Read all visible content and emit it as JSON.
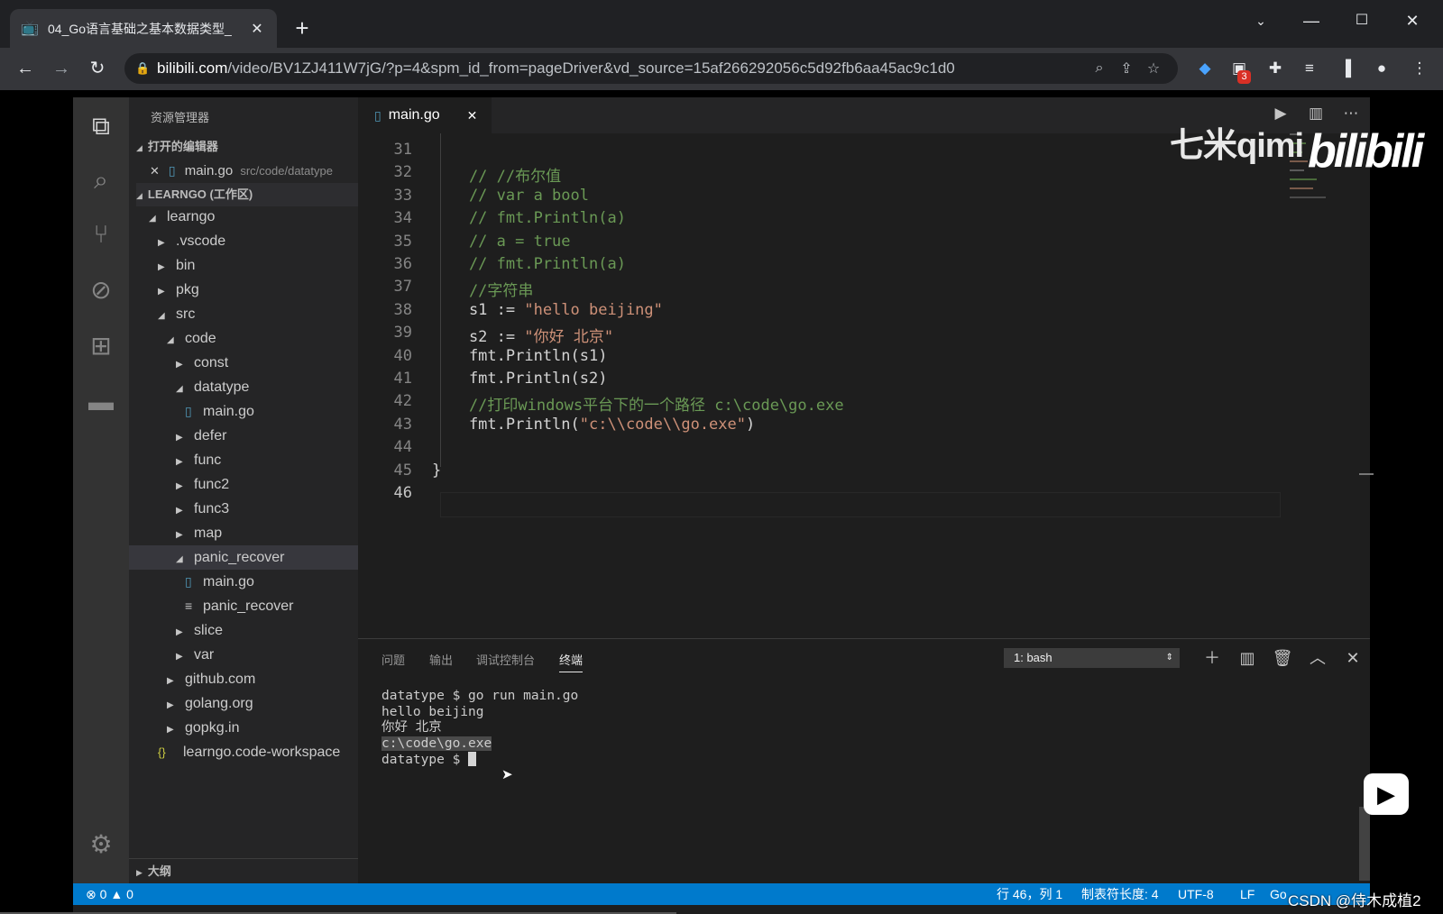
{
  "browser": {
    "tab_title": "04_Go语言基础之基本数据类型_",
    "tab_close": "✕",
    "new_tab": "+",
    "url_host": "bilibili.com",
    "url_path": "/video/BV1ZJ411W7jG/?p=4&spm_id_from=pageDriver&vd_source=15af266292056c5d92fb6aa45ac9c1d0",
    "ext_badge": "3"
  },
  "vscode": {
    "explorer_title": "资源管理器",
    "open_editors_label": "打开的编辑器",
    "open_editor": {
      "name": "main.go",
      "path": "src/code/datatype"
    },
    "workspace_label": "LEARNGO (工作区)",
    "tree": [
      {
        "label": "learngo",
        "indent": 0,
        "twisty": "open"
      },
      {
        "label": ".vscode",
        "indent": 1,
        "twisty": "closed"
      },
      {
        "label": "bin",
        "indent": 1,
        "twisty": "closed"
      },
      {
        "label": "pkg",
        "indent": 1,
        "twisty": "closed"
      },
      {
        "label": "src",
        "indent": 1,
        "twisty": "open"
      },
      {
        "label": "code",
        "indent": 2,
        "twisty": "open"
      },
      {
        "label": "const",
        "indent": 3,
        "twisty": "closed"
      },
      {
        "label": "datatype",
        "indent": 3,
        "twisty": "open"
      },
      {
        "label": "main.go",
        "indent": 4,
        "twisty": "go"
      },
      {
        "label": "defer",
        "indent": 3,
        "twisty": "closed"
      },
      {
        "label": "func",
        "indent": 3,
        "twisty": "closed"
      },
      {
        "label": "func2",
        "indent": 3,
        "twisty": "closed"
      },
      {
        "label": "func3",
        "indent": 3,
        "twisty": "closed"
      },
      {
        "label": "map",
        "indent": 3,
        "twisty": "closed"
      },
      {
        "label": "panic_recover",
        "indent": 3,
        "twisty": "open",
        "selected": true
      },
      {
        "label": "main.go",
        "indent": 4,
        "twisty": "go"
      },
      {
        "label": "panic_recover",
        "indent": 4,
        "twisty": "file"
      },
      {
        "label": "slice",
        "indent": 3,
        "twisty": "closed"
      },
      {
        "label": "var",
        "indent": 3,
        "twisty": "closed"
      },
      {
        "label": "github.com",
        "indent": 2,
        "twisty": "closed"
      },
      {
        "label": "golang.org",
        "indent": 2,
        "twisty": "closed"
      },
      {
        "label": "gopkg.in",
        "indent": 2,
        "twisty": "closed"
      },
      {
        "label": "learngo.code-workspace",
        "indent": 1,
        "twisty": "json"
      }
    ],
    "outline_label": "大纲",
    "editor_tab": "main.go",
    "code_lines": [
      {
        "n": "31",
        "segs": []
      },
      {
        "n": "32",
        "segs": [
          {
            "t": "    // //布尔值",
            "c": "cm"
          }
        ]
      },
      {
        "n": "33",
        "segs": [
          {
            "t": "    // var a bool",
            "c": "cm"
          }
        ]
      },
      {
        "n": "34",
        "segs": [
          {
            "t": "    // fmt.Println(a)",
            "c": "cm"
          }
        ]
      },
      {
        "n": "35",
        "segs": [
          {
            "t": "    // a = true",
            "c": "cm"
          }
        ]
      },
      {
        "n": "36",
        "segs": [
          {
            "t": "    // fmt.Println(a)",
            "c": "cm"
          }
        ]
      },
      {
        "n": "37",
        "segs": [
          {
            "t": "    //字符串",
            "c": "cm"
          }
        ]
      },
      {
        "n": "38",
        "segs": [
          {
            "t": "    s1 := ",
            "c": ""
          },
          {
            "t": "\"hello beijing\"",
            "c": "st"
          }
        ]
      },
      {
        "n": "39",
        "segs": [
          {
            "t": "    s2 := ",
            "c": ""
          },
          {
            "t": "\"你好 北京\"",
            "c": "st"
          }
        ]
      },
      {
        "n": "40",
        "segs": [
          {
            "t": "    fmt.Println(s1)",
            "c": ""
          }
        ]
      },
      {
        "n": "41",
        "segs": [
          {
            "t": "    fmt.Println(s2)",
            "c": ""
          }
        ]
      },
      {
        "n": "42",
        "segs": [
          {
            "t": "    //打印windows平台下的一个路径 c:\\code\\go.exe",
            "c": "cm"
          }
        ]
      },
      {
        "n": "43",
        "segs": [
          {
            "t": "    fmt.Println(",
            "c": ""
          },
          {
            "t": "\"c:\\\\code\\\\go.exe\"",
            "c": "st"
          },
          {
            "t": ")",
            "c": ""
          }
        ]
      },
      {
        "n": "44",
        "segs": []
      },
      {
        "n": "45",
        "segs": [
          {
            "t": "}",
            "c": ""
          }
        ]
      },
      {
        "n": "46",
        "segs": []
      }
    ],
    "watermark": "七米qimi",
    "bili_logo": "bilibili",
    "panel_tabs": [
      "问题",
      "输出",
      "调试控制台",
      "终端"
    ],
    "terminal_select": "1: bash",
    "terminal_lines": [
      "datatype $ go run main.go",
      "hello beijing",
      "你好 北京",
      "c:\\code\\go.exe",
      "datatype $ "
    ],
    "status": {
      "errors": "0",
      "warnings": "0",
      "position": "行 46，列 1",
      "tab_size": "制表符长度: 4",
      "encoding": "UTF-8",
      "eol": "LF",
      "lang": "Go"
    }
  },
  "overlay": {
    "csdn": "CSDN @侍木成植2"
  },
  "colors": {
    "accent": "#007acc",
    "comment": "#6a9955",
    "string": "#ce9178"
  }
}
